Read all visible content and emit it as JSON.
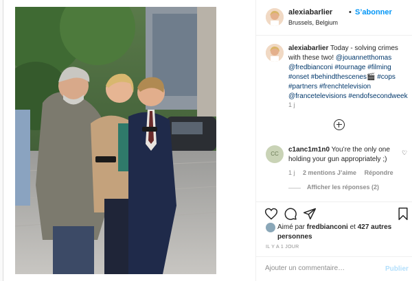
{
  "post": {
    "username": "alexiabarlier",
    "dot": "•",
    "follow_label": "S’abonner",
    "location": "Brussels, Belgium"
  },
  "caption": {
    "username": "alexiabarlier",
    "text_1": " Today - solving crimes with these two! ",
    "mention_1": "@jouannetthomas",
    "mention_2": "@fredbianconi",
    "hashtags_1": " #tournage #filming #onset #behindthescenes",
    "emoji": "🎬",
    "hashtags_2": " #cops #partners #frenchtelevision",
    "mention_3": "@francetelevisions",
    "hashtags_3": " #endofsecondweek",
    "time": "1 j"
  },
  "comment": {
    "avatar_initials": "CC",
    "username": "c1anc1m1n0",
    "text": " You’re the only one holding your gun appropriately ;)",
    "time": "1 j",
    "likes": "2 mentions J’aime",
    "reply_label": "Répondre",
    "view_replies": "Afficher les réponses (2)"
  },
  "likes": {
    "prefix": "Aimé par ",
    "user": "fredbianconi",
    "middle": " et ",
    "others": "427 autres personnes"
  },
  "timestamp": "IL Y A 1 JOUR",
  "add_comment": {
    "placeholder": "Ajouter un commentaire…",
    "publish_label": "Publier"
  },
  "icons": {
    "like": "heart-icon",
    "comment": "comment-icon",
    "share": "paper-plane-icon",
    "save": "bookmark-icon",
    "load_more": "plus-circle-icon"
  },
  "colors": {
    "link_blue": "#0095f6",
    "hashtag": "#00376b",
    "muted": "#8e8e8e",
    "publish_disabled": "#b2dffc"
  }
}
